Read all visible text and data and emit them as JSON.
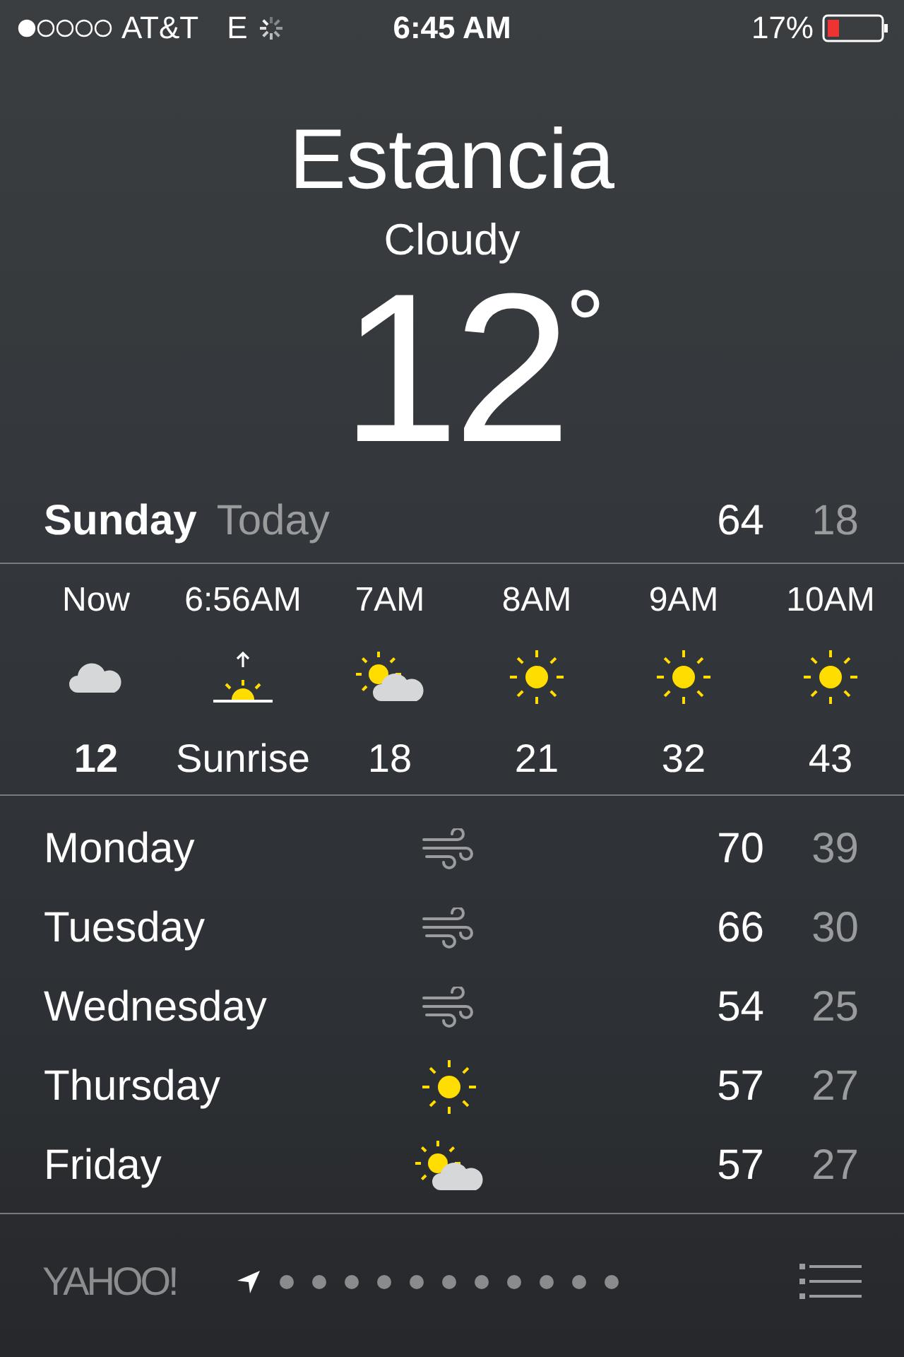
{
  "status_bar": {
    "carrier": "AT&T",
    "network": "E",
    "time": "6:45 AM",
    "battery": "17%"
  },
  "location": {
    "city": "Estancia",
    "condition": "Cloudy",
    "temperature": "12",
    "degree": "°"
  },
  "today": {
    "day": "Sunday",
    "label": "Today",
    "high": "64",
    "low": "18"
  },
  "hourly": [
    {
      "time": "Now",
      "kind": "cloudy",
      "value": "12",
      "emphasized": true
    },
    {
      "time": "6:56AM",
      "kind": "sunrise",
      "value": "Sunrise",
      "emphasized": false
    },
    {
      "time": "7AM",
      "kind": "partly-sunny",
      "value": "18",
      "emphasized": false
    },
    {
      "time": "8AM",
      "kind": "sunny",
      "value": "21",
      "emphasized": false
    },
    {
      "time": "9AM",
      "kind": "sunny",
      "value": "32",
      "emphasized": false
    },
    {
      "time": "10AM",
      "kind": "sunny",
      "value": "43",
      "emphasized": false
    }
  ],
  "daily": [
    {
      "day": "Monday",
      "kind": "windy",
      "high": "70",
      "low": "39"
    },
    {
      "day": "Tuesday",
      "kind": "windy",
      "high": "66",
      "low": "30"
    },
    {
      "day": "Wednesday",
      "kind": "windy",
      "high": "54",
      "low": "25"
    },
    {
      "day": "Thursday",
      "kind": "sunny",
      "high": "57",
      "low": "27"
    },
    {
      "day": "Friday",
      "kind": "partly-sunny",
      "high": "57",
      "low": "27"
    }
  ],
  "footer": {
    "logo": "YAHOO!",
    "pages": [
      {
        "kind": "location",
        "selected": true
      },
      {
        "kind": "city",
        "selected": false
      },
      {
        "kind": "city",
        "selected": false
      },
      {
        "kind": "city",
        "selected": false
      },
      {
        "kind": "city",
        "selected": false
      },
      {
        "kind": "city",
        "selected": false
      },
      {
        "kind": "city",
        "selected": false
      },
      {
        "kind": "city",
        "selected": false
      },
      {
        "kind": "city",
        "selected": false
      },
      {
        "kind": "city",
        "selected": false
      },
      {
        "kind": "city",
        "selected": false
      },
      {
        "kind": "city",
        "selected": false
      }
    ]
  }
}
